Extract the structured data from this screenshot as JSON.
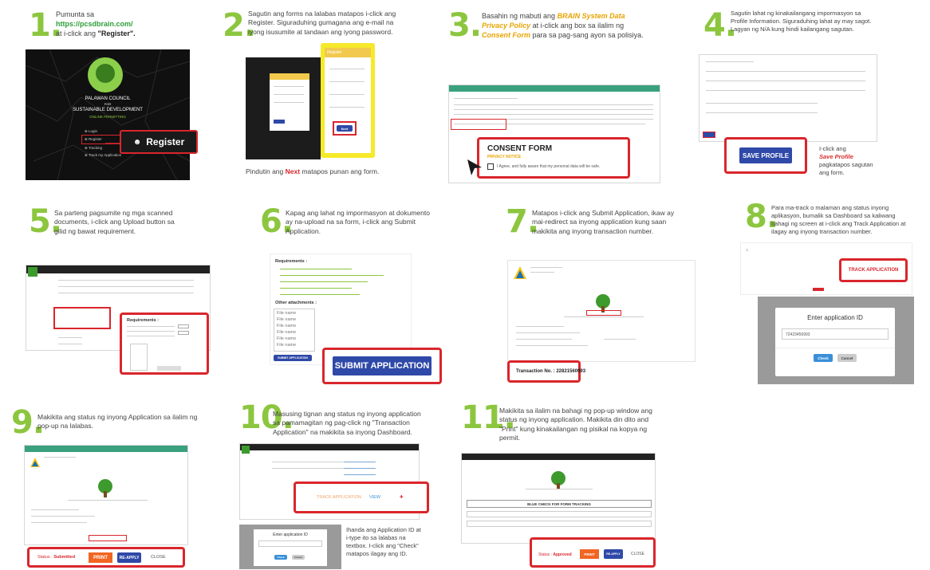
{
  "steps": [
    {
      "num": "1.",
      "text_a": "Pumunta sa",
      "text_link": "https://pcsdbrain.com/",
      "text_b": "at i-click ang",
      "text_c": "\"Register\"."
    },
    {
      "num": "2.",
      "text": "Sagutin ang forms na lalabas matapos i-click ang Register. Siguraduhing gumagana ang e-mail na iyong isusumite at tandaan ang iyong password.",
      "caption_a": "Pindutin ang",
      "caption_b": "Next",
      "caption_c": "matapos punan ang form."
    },
    {
      "num": "3.",
      "text_a": "Basahin ng mabuti ang",
      "text_b": "BRAIN System Data Privacy Policy",
      "text_c": "at i-click ang box sa ilalim ng",
      "text_d": "Consent Form",
      "text_e": "para sa pag-sang ayon sa polisiya."
    },
    {
      "num": "4.",
      "text": "Sagutin lahat ng kinakailangang impormasyon sa Profile Information. Siguraduhing lahat ay may sagot. Lagyan ng N/A kung hindi kailangang sagutan.",
      "caption_a": "I-click ang",
      "caption_b": "Save Profile",
      "caption_c": "pagkatapos sagutan ang form."
    },
    {
      "num": "5.",
      "text": "Sa parteng pagsumite ng mga scanned documents, i-click ang Upload button sa gilid ng bawat requirement."
    },
    {
      "num": "6.",
      "text": "Kapag ang lahat ng impormasyon at dokumento ay na-upload na sa form, i-click ang Submit Application."
    },
    {
      "num": "7.",
      "text": "Matapos i-click ang Submit Application, ikaw ay mai-redirect sa inyong application kung saan makikita ang inyong transaction number."
    },
    {
      "num": "8.",
      "text": "Para ma-track o malaman ang status inyong aplikasyon, bumalik sa Dashboard sa kaliwang bahagi ng screen at i-click ang Track Application at ilagay ang inyong transaction number."
    },
    {
      "num": "9.",
      "text": "Makikita ang status ng inyong Application sa ilalim ng pop-up na lalabas."
    },
    {
      "num": "10.",
      "text": "Masusing tignan ang status ng inyong application sa pamamagitan ng pag-click ng \"Transaction Application\" na makikita sa inyong Dashboard.",
      "caption": "Ihanda ang Application ID at i-type ito sa lalabas na textbox. I-click ang \"Check\" matapos ilagay ang ID."
    },
    {
      "num": "11.",
      "text": "Makikita sa ilalim na bahagi ng pop-up window ang status ng inyong application. Makikita din dito and \"Print\" kung kinakailangan ng pisikal na kopya ng permit."
    }
  ],
  "ui": {
    "register": "Register",
    "org_name": "PALAWAN COUNCIL",
    "org_for": "FOR",
    "org_sub": "SUSTAINABLE DEVELOPMENT",
    "online_permit": "ONLINE PERMITTING",
    "menu_login": "Login",
    "menu_register": "Register",
    "menu_tracking": "Tracking",
    "menu_track_app": "Track my Application",
    "consent_title": "CONSENT FORM",
    "consent_sub": "PRIVACY NOTICE",
    "consent_check": "I Agree, and fully aware that my personal data will be safe.",
    "save_profile": "SAVE PROFILE",
    "submit_application": "SUBMIT APPLICATION",
    "transaction_no": "Transaction No. : 22821560993",
    "track_application": "TRACK APPLICATION",
    "enter_app_id": "Enter application ID",
    "app_id_value": "72423456993",
    "check": "Check",
    "cancel": "Cancel",
    "status_label": "Status :",
    "status_submitted": "Submitted",
    "status_approved": "Approved",
    "print": "PRINT",
    "reapply": "RE-APPLY",
    "close": "CLOSE",
    "requirements": "Requirements :",
    "other_attachments": "Other attachments :",
    "upload": "Upload",
    "file_name": "File name",
    "register_title": "Register",
    "next": "Next",
    "view": "VIEW",
    "track_small": "TRACK",
    "permit_title": "BLUE CHECK FOR FORM TRACKING"
  },
  "colors": {
    "accent_green": "#8cc63f",
    "highlight_red": "#d9262c",
    "button_blue": "#2f49a8",
    "button_orange": "#f26522"
  }
}
